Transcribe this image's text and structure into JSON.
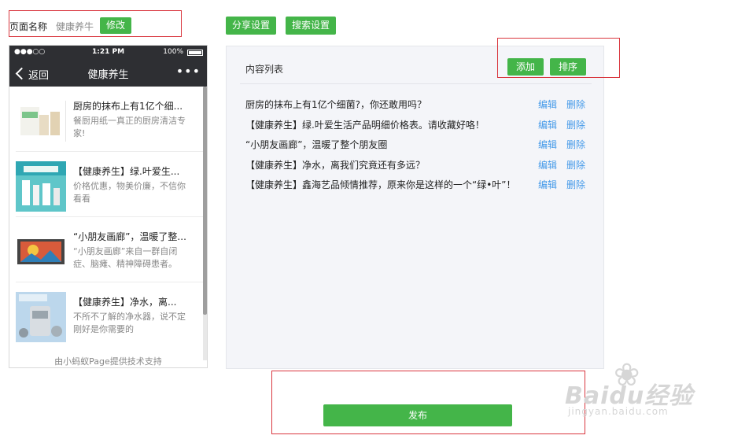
{
  "header": {
    "page_name_label": "页面名称",
    "page_name_value": "健康养牛",
    "modify_button": "修改",
    "share_settings_button": "分享设置",
    "search_settings_button": "搜索设置"
  },
  "phone": {
    "signal": "●●●○○",
    "time": "1:21 PM",
    "battery": "100%",
    "back_label": "返回",
    "nav_title": "健康养生",
    "more_label": "•••",
    "articles": [
      {
        "title": "厨房的抹布上有1亿个细...",
        "desc": "餐厨用纸一真正的厨房清洁专家!"
      },
      {
        "title": "【健康养生】绿.叶爱生...",
        "desc": "价格优惠，物美价廉，不信你看看"
      },
      {
        "title": "“小朋友画廊”，温暖了整...",
        "desc": "“小朋友画廊”来自一群自闭症、脑瘫、精神障碍患者。"
      },
      {
        "title": "【健康养生】净水，离...",
        "desc": "不所不了解的净水器，说不定刚好是你需要的"
      }
    ],
    "footer_note": "由小蚂蚁Page提供技术支持"
  },
  "content_list": {
    "title": "内容列表",
    "add_button": "添加",
    "sort_button": "排序",
    "edit_label": "编辑",
    "delete_label": "删除",
    "rows": [
      "厨房的抹布上有1亿个细菌?，你还敢用吗？",
      "【健康养生】绿.叶爱生活产品明细价格表。请收藏好咯！",
      "“小朋友画廊”，温暖了整个朋友圈",
      "【健康养生】净水，离我们究竟还有多远？",
      "【健康养生】鑫海艺品倾情推荐，原来你是这样的一个“绿•叶”！"
    ]
  },
  "publish_button": "发布",
  "watermark": {
    "brand": "Baidu经验",
    "url": "jingyan.baidu.com"
  },
  "colors": {
    "accent_green": "#44b549",
    "link_blue": "#459ae9",
    "annotation_red": "#d9363e"
  }
}
